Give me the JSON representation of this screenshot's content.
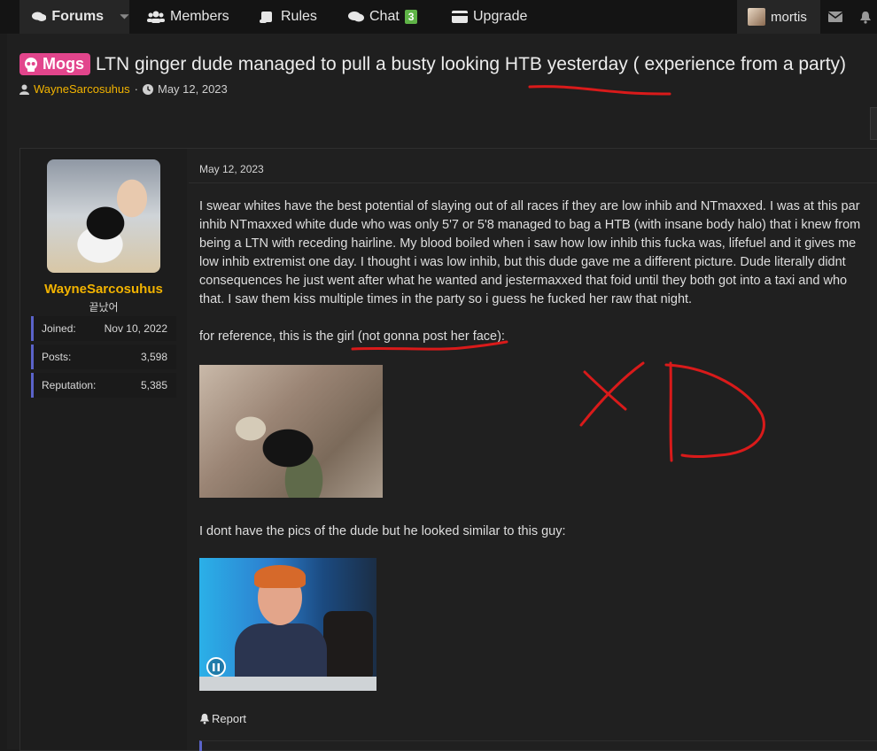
{
  "nav": {
    "forums": "Forums",
    "members": "Members",
    "rules": "Rules",
    "chat": "Chat",
    "chat_badge": "3",
    "upgrade": "Upgrade",
    "username": "mortis"
  },
  "thread": {
    "prefix": "Mogs",
    "title": "LTN ginger dude managed to pull a busty looking HTB yesterday ( experience from a party)",
    "author": "WayneSarcosuhus",
    "separator": "·",
    "date": "May 12, 2023"
  },
  "user": {
    "name": "WayneSarcosuhus",
    "title": "끝났어",
    "stats": [
      {
        "label": "Joined:",
        "value": "Nov 10, 2022"
      },
      {
        "label": "Posts:",
        "value": "3,598"
      },
      {
        "label": "Reputation:",
        "value": "5,385"
      }
    ]
  },
  "post": {
    "date": "May 12, 2023",
    "lines": [
      "I swear whites have the best potential of slaying out of all races if they are low inhib and NTmaxxed. I was at this par",
      "inhib NTmaxxed white dude who was only 5'7 or 5'8 managed to bag a HTB (with insane body halo) that i knew from",
      "being a LTN with receding hairline. My blood boiled when i saw how low inhib this fucka was, lifefuel and it gives me",
      "low inhib extremist one day. I thought i was low inhib, but this dude gave me a different picture. Dude literally didnt",
      "consequences he just went after what he wanted and jestermaxxed that foid until they both got into a taxi and who",
      "that. I saw them kiss multiple times in the party so i guess he fucked her raw that night."
    ],
    "reference": "for reference, this is the girl (not gonna post her face):",
    "dude_caption": "I dont have the pics of the dude but he looked similar to this guy:",
    "report": "Report"
  },
  "colors": {
    "accent": "#5a63c9",
    "author": "#f2b300",
    "prefix": "#e2458c",
    "annotation": "#d91a1a"
  }
}
